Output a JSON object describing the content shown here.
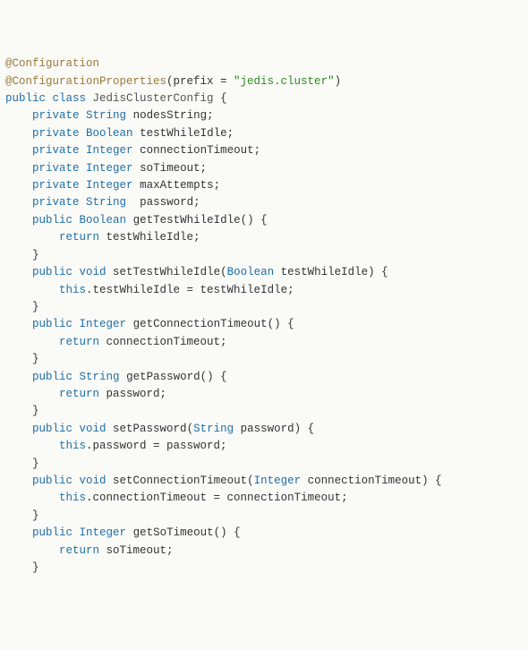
{
  "code": {
    "lines": [
      {
        "i": 0,
        "t": [
          {
            "c": "ann",
            "s": "@Configuration"
          }
        ]
      },
      {
        "i": 0,
        "t": [
          {
            "c": "ann",
            "s": "@ConfigurationProperties"
          },
          {
            "c": "pl",
            "s": "(prefix = "
          },
          {
            "c": "str",
            "s": "\"jedis.cluster\""
          },
          {
            "c": "pl",
            "s": ")"
          }
        ]
      },
      {
        "i": 0,
        "t": [
          {
            "c": "kw",
            "s": "public class"
          },
          {
            "c": "pl",
            "s": " "
          },
          {
            "c": "id",
            "s": "JedisClusterConfig"
          },
          {
            "c": "pl",
            "s": " {"
          }
        ]
      },
      {
        "i": 1,
        "t": [
          {
            "c": "kw",
            "s": "private"
          },
          {
            "c": "pl",
            "s": " "
          },
          {
            "c": "ty",
            "s": "String"
          },
          {
            "c": "pl",
            "s": " nodesString;"
          }
        ]
      },
      {
        "i": 1,
        "t": [
          {
            "c": "kw",
            "s": "private"
          },
          {
            "c": "pl",
            "s": " "
          },
          {
            "c": "ty",
            "s": "Boolean"
          },
          {
            "c": "pl",
            "s": " testWhileIdle;"
          }
        ]
      },
      {
        "i": 1,
        "t": [
          {
            "c": "kw",
            "s": "private"
          },
          {
            "c": "pl",
            "s": " "
          },
          {
            "c": "ty",
            "s": "Integer"
          },
          {
            "c": "pl",
            "s": " connectionTimeout;"
          }
        ]
      },
      {
        "i": 1,
        "t": [
          {
            "c": "kw",
            "s": "private"
          },
          {
            "c": "pl",
            "s": " "
          },
          {
            "c": "ty",
            "s": "Integer"
          },
          {
            "c": "pl",
            "s": " soTimeout;"
          }
        ]
      },
      {
        "i": 1,
        "t": [
          {
            "c": "kw",
            "s": "private"
          },
          {
            "c": "pl",
            "s": " "
          },
          {
            "c": "ty",
            "s": "Integer"
          },
          {
            "c": "pl",
            "s": " maxAttempts;"
          }
        ]
      },
      {
        "i": 1,
        "t": [
          {
            "c": "kw",
            "s": "private"
          },
          {
            "c": "pl",
            "s": " "
          },
          {
            "c": "ty",
            "s": "String"
          },
          {
            "c": "pl",
            "s": "  password;"
          }
        ]
      },
      {
        "i": 1,
        "t": [
          {
            "c": "kw",
            "s": "public"
          },
          {
            "c": "pl",
            "s": " "
          },
          {
            "c": "ty",
            "s": "Boolean"
          },
          {
            "c": "pl",
            "s": " "
          },
          {
            "c": "mname",
            "s": "getTestWhileIdle"
          },
          {
            "c": "pl",
            "s": "() {"
          }
        ]
      },
      {
        "i": 2,
        "t": [
          {
            "c": "kw",
            "s": "return"
          },
          {
            "c": "pl",
            "s": " testWhileIdle;"
          }
        ]
      },
      {
        "i": 1,
        "t": [
          {
            "c": "pl",
            "s": "}"
          }
        ]
      },
      {
        "i": 0,
        "t": [
          {
            "c": "pl",
            "s": ""
          }
        ]
      },
      {
        "i": 1,
        "t": [
          {
            "c": "kw",
            "s": "public void"
          },
          {
            "c": "pl",
            "s": " "
          },
          {
            "c": "mname",
            "s": "setTestWhileIdle"
          },
          {
            "c": "pl",
            "s": "("
          },
          {
            "c": "ty",
            "s": "Boolean"
          },
          {
            "c": "pl",
            "s": " testWhileIdle) {"
          }
        ]
      },
      {
        "i": 2,
        "t": [
          {
            "c": "kw",
            "s": "this"
          },
          {
            "c": "pl",
            "s": ".testWhileIdle = testWhileIdle;"
          }
        ]
      },
      {
        "i": 1,
        "t": [
          {
            "c": "pl",
            "s": "}"
          }
        ]
      },
      {
        "i": 0,
        "t": [
          {
            "c": "pl",
            "s": ""
          }
        ]
      },
      {
        "i": 1,
        "t": [
          {
            "c": "kw",
            "s": "public"
          },
          {
            "c": "pl",
            "s": " "
          },
          {
            "c": "ty",
            "s": "Integer"
          },
          {
            "c": "pl",
            "s": " "
          },
          {
            "c": "mname",
            "s": "getConnectionTimeout"
          },
          {
            "c": "pl",
            "s": "() {"
          }
        ]
      },
      {
        "i": 2,
        "t": [
          {
            "c": "kw",
            "s": "return"
          },
          {
            "c": "pl",
            "s": " connectionTimeout;"
          }
        ]
      },
      {
        "i": 1,
        "t": [
          {
            "c": "pl",
            "s": "}"
          }
        ]
      },
      {
        "i": 0,
        "t": [
          {
            "c": "pl",
            "s": ""
          }
        ]
      },
      {
        "i": 1,
        "t": [
          {
            "c": "kw",
            "s": "public"
          },
          {
            "c": "pl",
            "s": " "
          },
          {
            "c": "ty",
            "s": "String"
          },
          {
            "c": "pl",
            "s": " "
          },
          {
            "c": "mname",
            "s": "getPassword"
          },
          {
            "c": "pl",
            "s": "() {"
          }
        ]
      },
      {
        "i": 2,
        "t": [
          {
            "c": "kw",
            "s": "return"
          },
          {
            "c": "pl",
            "s": " password;"
          }
        ]
      },
      {
        "i": 1,
        "t": [
          {
            "c": "pl",
            "s": "}"
          }
        ]
      },
      {
        "i": 0,
        "t": [
          {
            "c": "pl",
            "s": ""
          }
        ]
      },
      {
        "i": 1,
        "t": [
          {
            "c": "kw",
            "s": "public void"
          },
          {
            "c": "pl",
            "s": " "
          },
          {
            "c": "mname",
            "s": "setPassword"
          },
          {
            "c": "pl",
            "s": "("
          },
          {
            "c": "ty",
            "s": "String"
          },
          {
            "c": "pl",
            "s": " password) {"
          }
        ]
      },
      {
        "i": 2,
        "t": [
          {
            "c": "kw",
            "s": "this"
          },
          {
            "c": "pl",
            "s": ".password = password;"
          }
        ]
      },
      {
        "i": 1,
        "t": [
          {
            "c": "pl",
            "s": "}"
          }
        ]
      },
      {
        "i": 0,
        "t": [
          {
            "c": "pl",
            "s": ""
          }
        ]
      },
      {
        "i": 1,
        "t": [
          {
            "c": "kw",
            "s": "public void"
          },
          {
            "c": "pl",
            "s": " "
          },
          {
            "c": "mname",
            "s": "setConnectionTimeout"
          },
          {
            "c": "pl",
            "s": "("
          },
          {
            "c": "ty",
            "s": "Integer"
          },
          {
            "c": "pl",
            "s": " connectionTimeout) {"
          }
        ]
      },
      {
        "i": 2,
        "t": [
          {
            "c": "kw",
            "s": "this"
          },
          {
            "c": "pl",
            "s": ".connectionTimeout = connectionTimeout;"
          }
        ]
      },
      {
        "i": 1,
        "t": [
          {
            "c": "pl",
            "s": "}"
          }
        ]
      },
      {
        "i": 0,
        "t": [
          {
            "c": "pl",
            "s": ""
          }
        ]
      },
      {
        "i": 1,
        "t": [
          {
            "c": "kw",
            "s": "public"
          },
          {
            "c": "pl",
            "s": " "
          },
          {
            "c": "ty",
            "s": "Integer"
          },
          {
            "c": "pl",
            "s": " "
          },
          {
            "c": "mname",
            "s": "getSoTimeout"
          },
          {
            "c": "pl",
            "s": "() {"
          }
        ]
      },
      {
        "i": 2,
        "t": [
          {
            "c": "kw",
            "s": "return"
          },
          {
            "c": "pl",
            "s": " soTimeout;"
          }
        ]
      },
      {
        "i": 1,
        "t": [
          {
            "c": "pl",
            "s": "}"
          }
        ]
      }
    ],
    "indentUnit": "    "
  }
}
